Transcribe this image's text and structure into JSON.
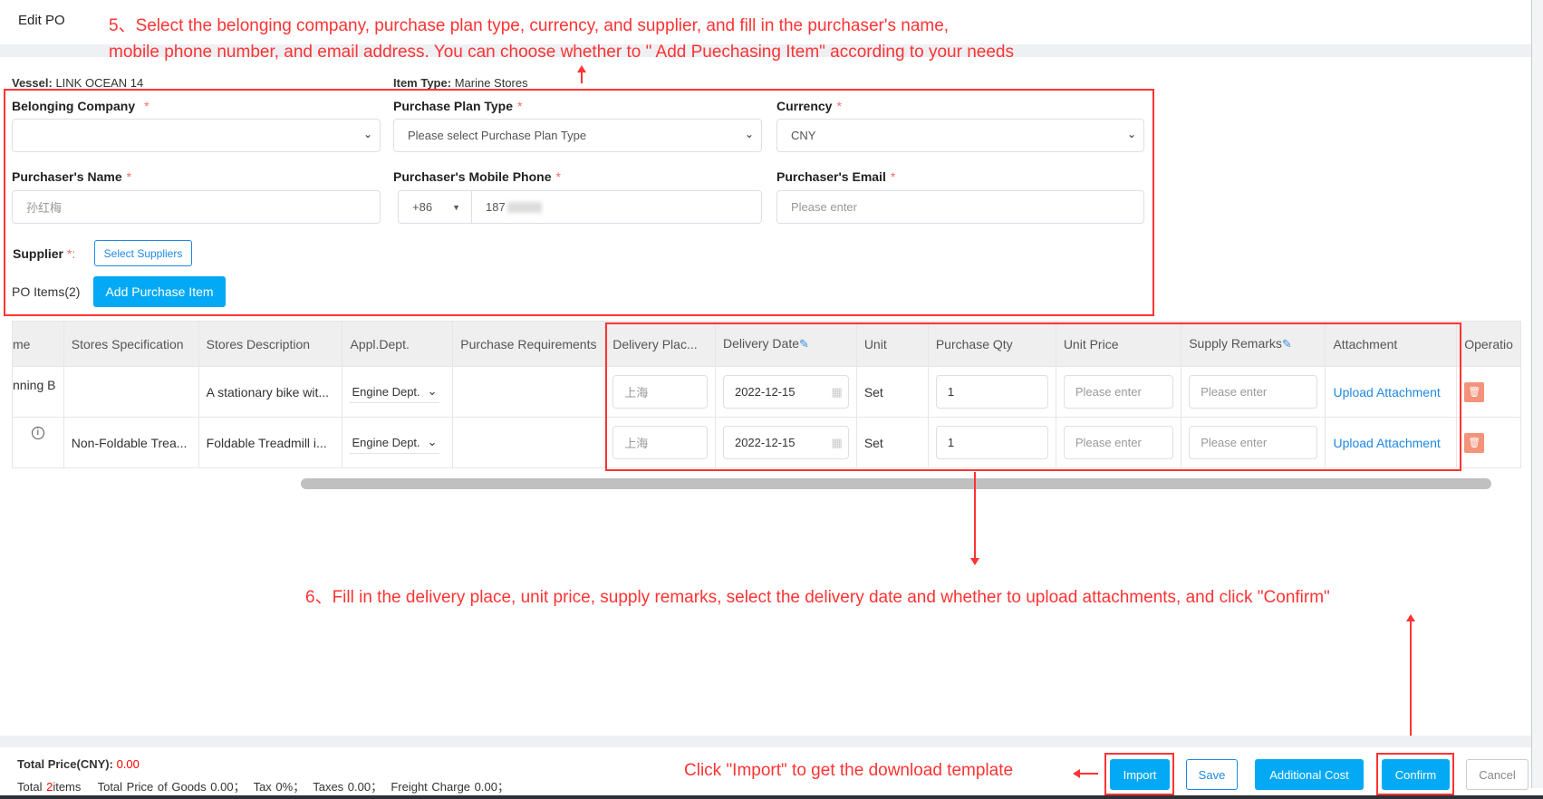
{
  "header": {
    "title": "Edit PO"
  },
  "annotations": {
    "step5_line1": "5、Select the belonging company, purchase plan type, currency, and supplier, and fill in the purchaser's name,",
    "step5_line2": "mobile phone number, and email address. You can choose whether to \" Add Puechasing Item\" according to your needs",
    "step6": "6、Fill in the delivery place, unit price, supply remarks, select the delivery date and whether to upload attachments, and click \"Confirm\"",
    "import_note": "Click \"Import\" to get the download template"
  },
  "info": {
    "vessel_label": "Vessel:",
    "vessel_value": "LINK OCEAN 14",
    "item_type_label": "Item Type:",
    "item_type_value": "Marine Stores"
  },
  "form": {
    "belonging_company": {
      "label": "Belonging Company",
      "value": ""
    },
    "purchase_plan_type": {
      "label": "Purchase Plan Type",
      "placeholder": "Please select Purchase Plan Type"
    },
    "currency": {
      "label": "Currency",
      "value": "CNY"
    },
    "purchaser_name": {
      "label": "Purchaser's Name",
      "value": "孙红梅"
    },
    "purchaser_phone": {
      "label": "Purchaser's Mobile Phone",
      "country_code": "+86",
      "value": "187"
    },
    "purchaser_email": {
      "label": "Purchaser's Email",
      "placeholder": "Please enter"
    },
    "required_mark": "*",
    "supplier_label": "Supplier",
    "supplier_suffix": "*:",
    "select_suppliers": "Select Suppliers",
    "po_items": "PO Items(2)",
    "add_item": "Add Purchase Item"
  },
  "table": {
    "columns": [
      "me",
      "Stores Specification",
      "Stores Description",
      "Appl.Dept.",
      "Purchase Requirements",
      "Delivery Plac...",
      "Delivery Date",
      "Unit",
      "Purchase Qty",
      "Unit Price",
      "Supply Remarks",
      "Attachment",
      "Operatio"
    ],
    "rows": [
      {
        "name": "nning B",
        "spec": "",
        "desc": "A stationary bike wit...",
        "dept": "Engine Dept.",
        "req": "",
        "place": "上海",
        "date": "2022-12-15",
        "unit": "Set",
        "qty": "1",
        "price_ph": "Please enter",
        "remarks_ph": "Please enter",
        "attachment": "Upload Attachment"
      },
      {
        "name": "",
        "spec": "Non-Foldable Trea...",
        "desc": "Foldable Treadmill i...",
        "dept": "Engine Dept.",
        "req": "",
        "place": "上海",
        "date": "2022-12-15",
        "unit": "Set",
        "qty": "1",
        "price_ph": "Please enter",
        "remarks_ph": "Please enter",
        "attachment": "Upload Attachment"
      }
    ]
  },
  "footer": {
    "total_price_label": "Total Price(CNY):",
    "total_price_value": "0.00",
    "total_prefix": "Total ",
    "total_count": "2",
    "total_suffix": "items",
    "goods": "Total Price of Goods 0.00；",
    "tax": "Tax 0%；",
    "taxes": "Taxes 0.00；",
    "freight": "Freight Charge 0.00；",
    "buttons": {
      "import": "Import",
      "save": "Save",
      "additional_cost": "Additional Cost",
      "confirm": "Confirm",
      "cancel": "Cancel"
    }
  },
  "colors": {
    "primary": "#03a9f4",
    "annotation": "#ff3333",
    "required": "#f56c6c",
    "link": "#1e88e5"
  }
}
